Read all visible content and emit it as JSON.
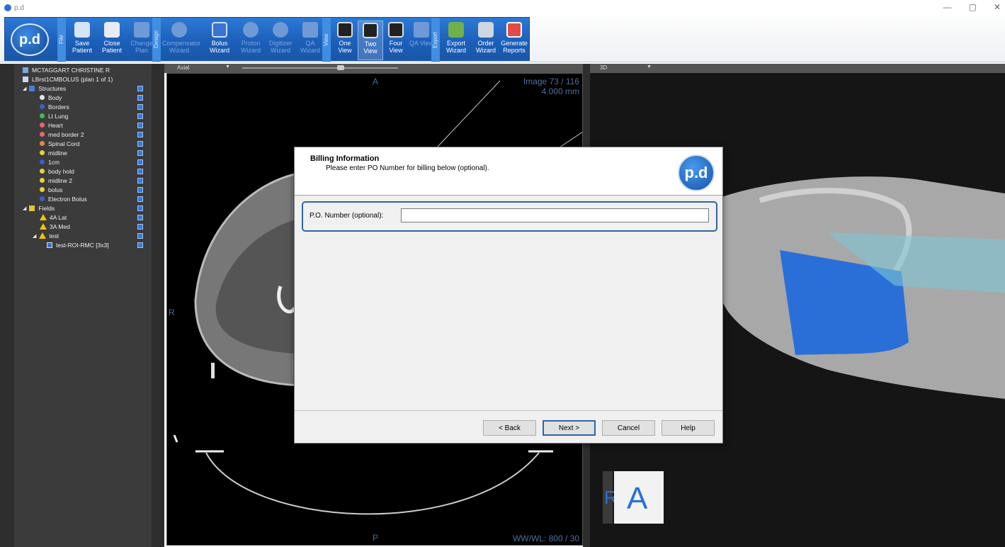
{
  "window": {
    "title": "p.d",
    "controls": [
      "—",
      "▢",
      "✕"
    ]
  },
  "ribbon": {
    "logo_text": "p.d",
    "groups": {
      "file": "File",
      "design": "Design",
      "view": "View",
      "export": "Export"
    },
    "buttons": {
      "save_patient": "Save Patient",
      "close_patient": "Close Patient",
      "change_plan": "Change Plan",
      "compensator_wizard": "Compensator Wizard",
      "bolus_wizard": "Bolus Wizard",
      "proton_wizard": "Proton Wizard",
      "digitizer_wizard": "Digitizer Wizard",
      "qa_wizard": "QA Wizard",
      "one_view": "One View",
      "two_view": "Two View",
      "four_view": "Four View",
      "qa_view": "QA View",
      "export_wizard": "Export Wizard",
      "order_wizard": "Order Wizard",
      "generate_reports": "Generate Reports"
    }
  },
  "tree": {
    "patient": "MCTAGGART CHRISTINE R",
    "plan": "LBrst1CMBOLUS (plan 1 of 1)",
    "structures_label": "Structures",
    "structures": [
      {
        "name": "Body",
        "color": "#e6e6e6"
      },
      {
        "name": "Borders",
        "color": "#3a5fd0"
      },
      {
        "name": "Lt Lung",
        "color": "#3cc34a"
      },
      {
        "name": "Heart",
        "color": "#e36a6a"
      },
      {
        "name": "med border 2",
        "color": "#e36a6a"
      },
      {
        "name": "Spinal Cord",
        "color": "#e38a3a"
      },
      {
        "name": "midline",
        "color": "#e6d23a"
      },
      {
        "name": "1cm",
        "color": "#3a5fd0"
      },
      {
        "name": "body hold",
        "color": "#e6d23a"
      },
      {
        "name": "midline 2",
        "color": "#e6d23a"
      },
      {
        "name": "bolus",
        "color": "#e6d23a"
      },
      {
        "name": "Electron Bolus",
        "color": "#3a5fd0"
      }
    ],
    "fields_label": "Fields",
    "fields": [
      "4A Lat",
      "3A Med",
      "test"
    ],
    "subfield": "test-ROI-RMC [3x3]"
  },
  "axial": {
    "view_select": "Axial",
    "top_label": "A",
    "left_label": "R",
    "bottom_label": "P",
    "image_info": "Image 73 / 116",
    "slice_thickness": "4.000 mm",
    "wwwl": "WW/WL: 800 / 30"
  },
  "view3d": {
    "view_select": "3D",
    "orient_r": "R",
    "orient_a": "A"
  },
  "dialog": {
    "title": "Billing Information",
    "subtitle": "Please enter PO Number for billing below (optional).",
    "logo_text": "p.d",
    "po_label": "P.O. Number (optional):",
    "po_value": "",
    "back": "< Back",
    "next": "Next >",
    "cancel": "Cancel",
    "help": "Help"
  }
}
